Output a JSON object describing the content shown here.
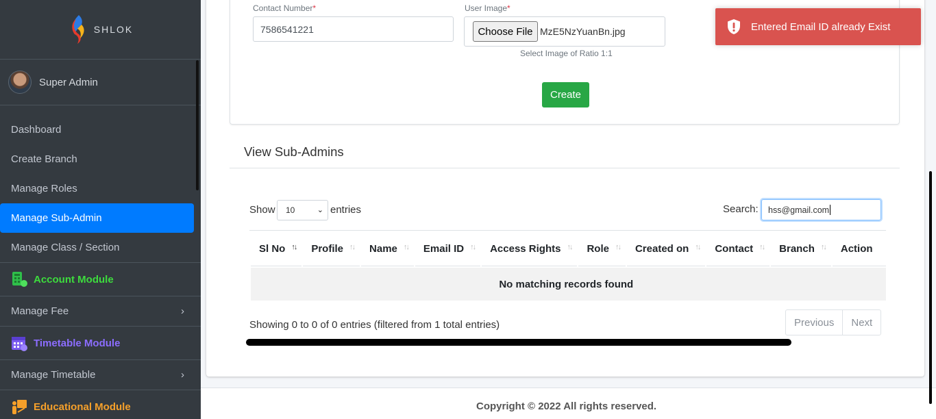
{
  "brand": {
    "name": "SHLOK"
  },
  "user": {
    "name": "Super Admin"
  },
  "sidebar": {
    "items": [
      {
        "label": "Dashboard"
      },
      {
        "label": "Create Branch"
      },
      {
        "label": "Manage Roles"
      },
      {
        "label": "Manage Sub-Admin",
        "active": true
      },
      {
        "label": "Manage Class / Section"
      }
    ],
    "modules": [
      {
        "label": "Account Module",
        "color": "#3ddc3d",
        "icon": "account-module-icon",
        "item": "Manage Fee"
      },
      {
        "label": "Timetable Module",
        "color": "#8c6dff",
        "icon": "timetable-module-icon",
        "item": "Manage Timetable"
      },
      {
        "label": "Educational Module",
        "color": "#f6a02a",
        "icon": "educational-module-icon"
      }
    ]
  },
  "form": {
    "contact_label": "Contact Number",
    "contact_value": "7586541221",
    "image_label": "User Image",
    "file_button": "Choose File",
    "file_name": "MzE5NzYuanBn.jpg",
    "image_hint": "Select Image of Ratio 1:1",
    "create_label": "Create",
    "required_mark": "*"
  },
  "section": {
    "title": "View Sub-Admins"
  },
  "table_controls": {
    "show": "Show",
    "length_value": "10",
    "entries": "entries",
    "search_label": "Search:",
    "search_value": "hss@gmail.com"
  },
  "table": {
    "columns": [
      "Sl No",
      "Profile",
      "Name",
      "Email ID",
      "Access Rights",
      "Role",
      "Created on",
      "Contact",
      "Branch",
      "Action"
    ],
    "empty_message": "No matching records found",
    "info": "Showing 0 to 0 of 0 entries (filtered from 1 total entries)",
    "prev": "Previous",
    "next": "Next"
  },
  "footer": {
    "text": "Copyright © 2022 All rights reserved."
  },
  "toast": {
    "message": "Entered Email ID already Exist",
    "color": "#d9534f"
  },
  "colors": {
    "sidebar": "#343a40",
    "active": "#007bff",
    "create": "#28a745"
  }
}
